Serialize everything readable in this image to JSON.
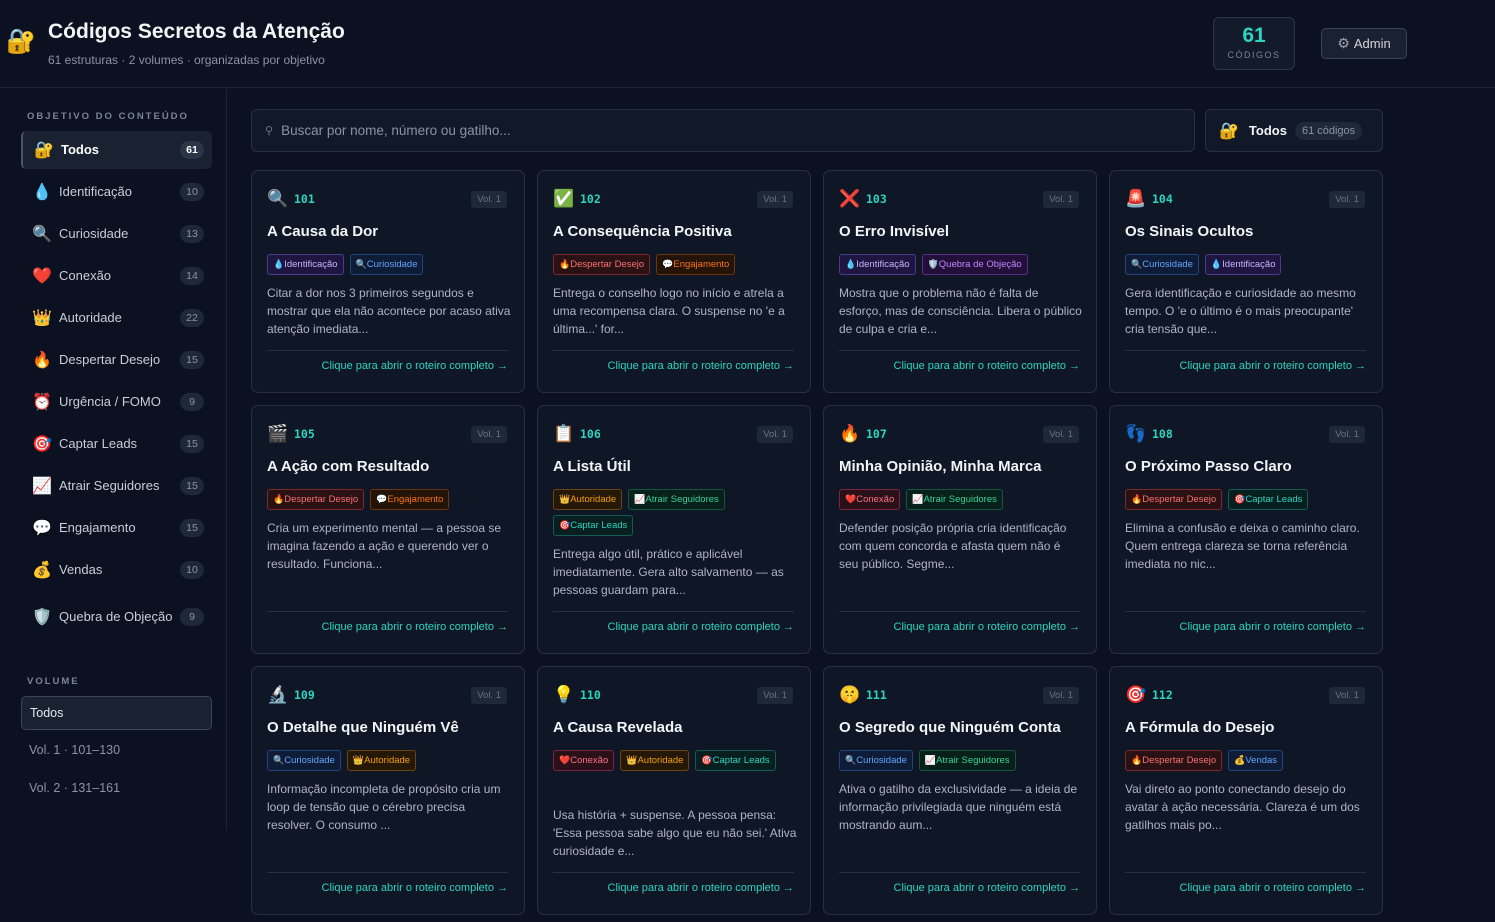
{
  "header": {
    "logo_icon": "lock-with-key-icon",
    "title": "Códigos Secretos da Atenção",
    "subtitle": "61 estruturas · 2 volumes · organizadas por objetivo",
    "count_value": "61",
    "count_label": "CÓDIGOS",
    "admin_label": "Admin",
    "admin_icon": "gear-icon"
  },
  "sidebar": {
    "objective_heading": "OBJETIVO DO CONTEÚDO",
    "items": [
      {
        "icon": "🔐",
        "label": "Todos",
        "count": "61"
      },
      {
        "icon": "💧",
        "label": "Identificação",
        "count": "10"
      },
      {
        "icon": "🔍",
        "label": "Curiosidade",
        "count": "13"
      },
      {
        "icon": "❤️",
        "label": "Conexão",
        "count": "14"
      },
      {
        "icon": "👑",
        "label": "Autoridade",
        "count": "22"
      },
      {
        "icon": "🔥",
        "label": "Despertar Desejo",
        "count": "15"
      },
      {
        "icon": "⏰",
        "label": "Urgência / FOMO",
        "count": "9"
      },
      {
        "icon": "🎯",
        "label": "Captar Leads",
        "count": "15"
      },
      {
        "icon": "📈",
        "label": "Atrair Seguidores",
        "count": "15"
      },
      {
        "icon": "💬",
        "label": "Engajamento",
        "count": "15"
      },
      {
        "icon": "💰",
        "label": "Vendas",
        "count": "10"
      },
      {
        "icon": "🛡️",
        "label": "Quebra de Objeção",
        "count": "9"
      }
    ],
    "volume_heading": "VOLUME",
    "volumes": [
      "Todos",
      "Vol. 1 · 101–130",
      "Vol. 2 · 131–161"
    ]
  },
  "search": {
    "placeholder": "Buscar por nome, número ou gatilho...",
    "value": ""
  },
  "filter": {
    "icon": "🔐",
    "label": "Todos",
    "count": "61 códigos"
  },
  "footer_label": "Clique para abrir o roteiro completo →",
  "tag_styles": {
    "Identificação": {
      "icon": "💧",
      "fg": "#c4b5fd",
      "bg": "#1e1641",
      "bd": "#4c3a8a"
    },
    "Curiosidade": {
      "icon": "🔍",
      "fg": "#60a5fa",
      "bg": "#0f1c38",
      "bd": "#24447a"
    },
    "Despertar Desejo": {
      "icon": "🔥",
      "fg": "#f87171",
      "bg": "#2a1113",
      "bd": "#7a2a2a"
    },
    "Engajamento": {
      "icon": "💬",
      "fg": "#f97316",
      "bg": "#241307",
      "bd": "#6b3510"
    },
    "Quebra de Objeção": {
      "icon": "🛡️",
      "fg": "#c084fc",
      "bg": "#23103a",
      "bd": "#5b2d8a"
    },
    "Autoridade": {
      "icon": "👑",
      "fg": "#f59e0b",
      "bg": "#261806",
      "bd": "#6b4510"
    },
    "Atrair Seguidores": {
      "icon": "📈",
      "fg": "#34d399",
      "bg": "#08201a",
      "bd": "#16553f"
    },
    "Captar Leads": {
      "icon": "🎯",
      "fg": "#2dd4bf",
      "bg": "#07201f",
      "bd": "#155a55"
    },
    "Conexão": {
      "icon": "❤️",
      "fg": "#fb7185",
      "bg": "#2a1018",
      "bd": "#7a2540"
    },
    "Vendas": {
      "icon": "💰",
      "fg": "#60a5fa",
      "bg": "#0f1c38",
      "bd": "#24447a"
    }
  },
  "cards": [
    {
      "icon": "🔍",
      "num": "101",
      "vol": "Vol. 1",
      "title": "A Causa da Dor",
      "tags": [
        "Identificação",
        "Curiosidade"
      ],
      "desc": "Citar a dor nos 3 primeiros segundos e mostrar que ela não acontece por acaso ativa atenção imediata..."
    },
    {
      "icon": "✅",
      "num": "102",
      "vol": "Vol. 1",
      "title": "A Consequência Positiva",
      "tags": [
        "Despertar Desejo",
        "Engajamento"
      ],
      "desc": "Entrega o conselho logo no início e atrela a uma recompensa clara. O suspense no 'e a última...' for..."
    },
    {
      "icon": "❌",
      "num": "103",
      "vol": "Vol. 1",
      "title": "O Erro Invisível",
      "tags": [
        "Identificação",
        "Quebra de Objeção"
      ],
      "desc": "Mostra que o problema não é falta de esforço, mas de consciência. Libera o público de culpa e cria e..."
    },
    {
      "icon": "🚨",
      "num": "104",
      "vol": "Vol. 1",
      "title": "Os Sinais Ocultos",
      "tags": [
        "Curiosidade",
        "Identificação"
      ],
      "desc": "Gera identificação e curiosidade ao mesmo tempo. O 'e o último é o mais preocupante' cria tensão que..."
    },
    {
      "icon": "🎬",
      "num": "105",
      "vol": "Vol. 1",
      "title": "A Ação com Resultado",
      "tags": [
        "Despertar Desejo",
        "Engajamento"
      ],
      "desc": "Cria um experimento mental — a pessoa se imagina fazendo a ação e querendo ver o resultado. Funciona..."
    },
    {
      "icon": "📋",
      "num": "106",
      "vol": "Vol. 1",
      "title": "A Lista Útil",
      "tags": [
        "Autoridade",
        "Atrair Seguidores",
        "Captar Leads"
      ],
      "desc": "Entrega algo útil, prático e aplicável imediatamente. Gera alto salvamento — as pessoas guardam para..."
    },
    {
      "icon": "🔥",
      "num": "107",
      "vol": "Vol. 1",
      "title": "Minha Opinião, Minha Marca",
      "tags": [
        "Conexão",
        "Atrair Seguidores"
      ],
      "desc": "Defender posição própria cria identificação com quem concorda e afasta quem não é seu público. Segme..."
    },
    {
      "icon": "👣",
      "num": "108",
      "vol": "Vol. 1",
      "title": "O Próximo Passo Claro",
      "tags": [
        "Despertar Desejo",
        "Captar Leads"
      ],
      "desc": "Elimina a confusão e deixa o caminho claro. Quem entrega clareza se torna referência imediata no nic..."
    },
    {
      "icon": "🔬",
      "num": "109",
      "vol": "Vol. 1",
      "title": "O Detalhe que Ninguém Vê",
      "tags": [
        "Curiosidade",
        "Autoridade"
      ],
      "desc": "Informação incompleta de propósito cria um loop de tensão que o cérebro precisa resolver. O consumo ..."
    },
    {
      "icon": "💡",
      "num": "110",
      "vol": "Vol. 1",
      "title": "A Causa Revelada",
      "tags": [
        "Conexão",
        "Autoridade",
        "Captar Leads"
      ],
      "desc": "Usa história + suspense. A pessoa pensa: 'Essa pessoa sabe algo que eu não sei.' Ativa curiosidade e..."
    },
    {
      "icon": "🤫",
      "num": "111",
      "vol": "Vol. 1",
      "title": "O Segredo que Ninguém Conta",
      "tags": [
        "Curiosidade",
        "Atrair Seguidores"
      ],
      "desc": "Ativa o gatilho da exclusividade — a ideia de informação privilegiada que ninguém está mostrando aum..."
    },
    {
      "icon": "🎯",
      "num": "112",
      "vol": "Vol. 1",
      "title": "A Fórmula do Desejo",
      "tags": [
        "Despertar Desejo",
        "Vendas"
      ],
      "desc": "Vai direto ao ponto conectando desejo do avatar à ação necessária. Clareza é um dos gatilhos mais po..."
    }
  ]
}
